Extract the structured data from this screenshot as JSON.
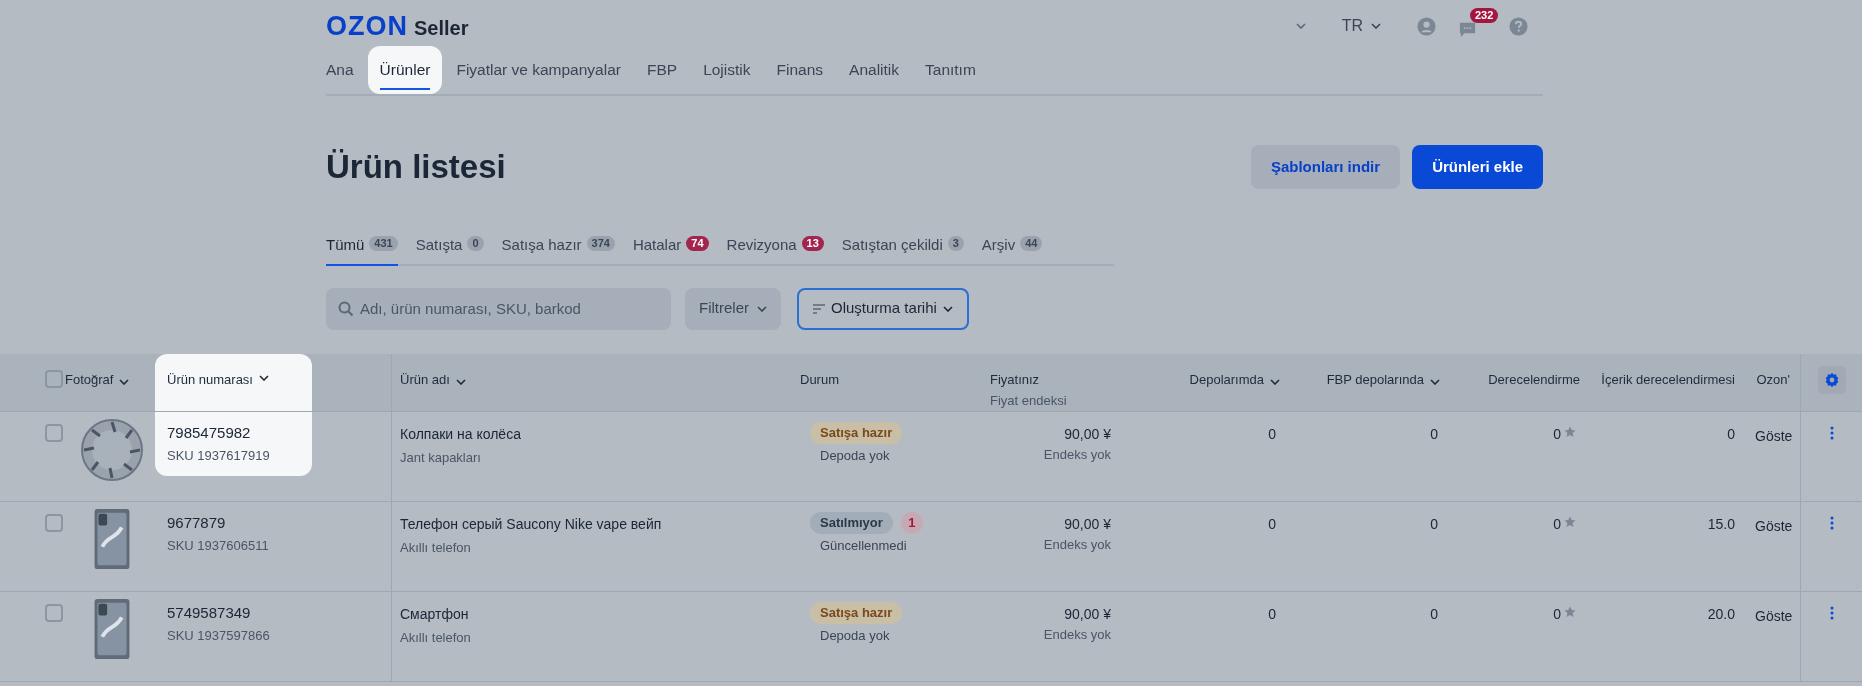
{
  "header": {
    "logo": {
      "brand": "OZON",
      "product": "Seller"
    },
    "language": "TR",
    "messages_badge": "232"
  },
  "nav": [
    {
      "label": "Ana",
      "selected": false,
      "highlighted": false
    },
    {
      "label": "Ürünler",
      "selected": true,
      "highlighted": true
    },
    {
      "label": "Fiyatlar ve kampanyalar",
      "selected": false,
      "highlighted": false
    },
    {
      "label": "FBP",
      "selected": false,
      "highlighted": false
    },
    {
      "label": "Lojistik",
      "selected": false,
      "highlighted": false
    },
    {
      "label": "Finans",
      "selected": false,
      "highlighted": false
    },
    {
      "label": "Analitik",
      "selected": false,
      "highlighted": false
    },
    {
      "label": "Tanıtım",
      "selected": false,
      "highlighted": false
    }
  ],
  "page_title": "Ürün listesi",
  "actions": [
    {
      "label": "Şablonları indir",
      "kind": "secondary"
    },
    {
      "label": "Ürünleri ekle",
      "kind": "primary"
    }
  ],
  "status_tabs": [
    {
      "label": "Tümü",
      "count": "431",
      "selected": true,
      "color": "#9aa3ad"
    },
    {
      "label": "Satışta",
      "count": "0",
      "selected": false,
      "color": "#9aa3ad"
    },
    {
      "label": "Satışa hazır",
      "count": "374",
      "selected": false,
      "color": "#9aa3ad"
    },
    {
      "label": "Hatalar",
      "count": "74",
      "selected": false,
      "color": "#a3244f"
    },
    {
      "label": "Revizyona",
      "count": "13",
      "selected": false,
      "color": "#a3244f"
    },
    {
      "label": "Satıştan çekildi",
      "count": "3",
      "selected": false,
      "color": "#9aa3ad"
    },
    {
      "label": "Arşiv",
      "count": "44",
      "selected": false,
      "color": "#9aa3ad"
    }
  ],
  "toolbar": {
    "search": {
      "placeholder": "Adı, ürün numarası, SKU, barkod"
    },
    "filters": "Filtreler",
    "sort": "Oluşturma tarihi"
  },
  "table": {
    "select_all_checked": false,
    "columns": [
      {
        "label": "Fotoğraf",
        "sortable": true,
        "highlighted": false
      },
      {
        "label": "Ürün numarası",
        "sortable": true,
        "highlighted": true
      },
      {
        "label": "Ürün adı",
        "sortable": true,
        "highlighted": false
      },
      {
        "label": "Durum",
        "sortable": false,
        "highlighted": false
      },
      {
        "label": "Fiyatınız",
        "sublabel": "Fiyat endeksi",
        "sortable": false,
        "highlighted": false
      },
      {
        "label": "Depolarımda",
        "sortable": true,
        "highlighted": false
      },
      {
        "label": "FBP depolarında",
        "sortable": true,
        "highlighted": false
      },
      {
        "label": "Derecelendirme",
        "sortable": false,
        "highlighted": false
      },
      {
        "label": "İçerik derecelendirmesi",
        "sortable": false,
        "highlighted": false
      },
      {
        "label": "Ozon'",
        "sortable": false,
        "highlighted": false
      }
    ],
    "rows": [
      {
        "kind": "wheel-cover",
        "checked": false,
        "number": "7985475982",
        "sku": "SKU 1937617919",
        "highlighted": true,
        "name": "Колпаки на колёса",
        "category": "Jant kapakları",
        "status": {
          "label": "Satışa hazır",
          "kind": "ready"
        },
        "status_note": "Depoda yok",
        "price": "90,00 ¥",
        "price_index": "Endeks yok",
        "stock": "0",
        "fbp_stock": "0",
        "rating": "0",
        "content_rating": "0",
        "ozon": "Göste"
      },
      {
        "kind": "phone",
        "checked": false,
        "number": "9677879",
        "sku": "SKU 1937606511",
        "highlighted": false,
        "name": "Телефон серый Saucony Nike vape вейп",
        "category": "Akıllı telefon",
        "status": {
          "label": "Satılmıyor",
          "kind": "not-selling"
        },
        "warnings": "1",
        "status_note": "Güncellenmedi",
        "price": "90,00 ¥",
        "price_index": "Endeks yok",
        "stock": "0",
        "fbp_stock": "0",
        "rating": "0",
        "content_rating": "15.0",
        "ozon": "Göste"
      },
      {
        "kind": "phone",
        "checked": false,
        "number": "5749587349",
        "sku": "SKU 1937597866",
        "highlighted": false,
        "name": "Смартфон",
        "category": "Akıllı telefon",
        "status": {
          "label": "Satışa hazır",
          "kind": "ready"
        },
        "status_note": "Depoda yok",
        "price": "90,00 ¥",
        "price_index": "Endeks yok",
        "stock": "0",
        "fbp_stock": "0",
        "rating": "0",
        "content_rating": "20.0",
        "ozon": "Göste"
      }
    ]
  }
}
